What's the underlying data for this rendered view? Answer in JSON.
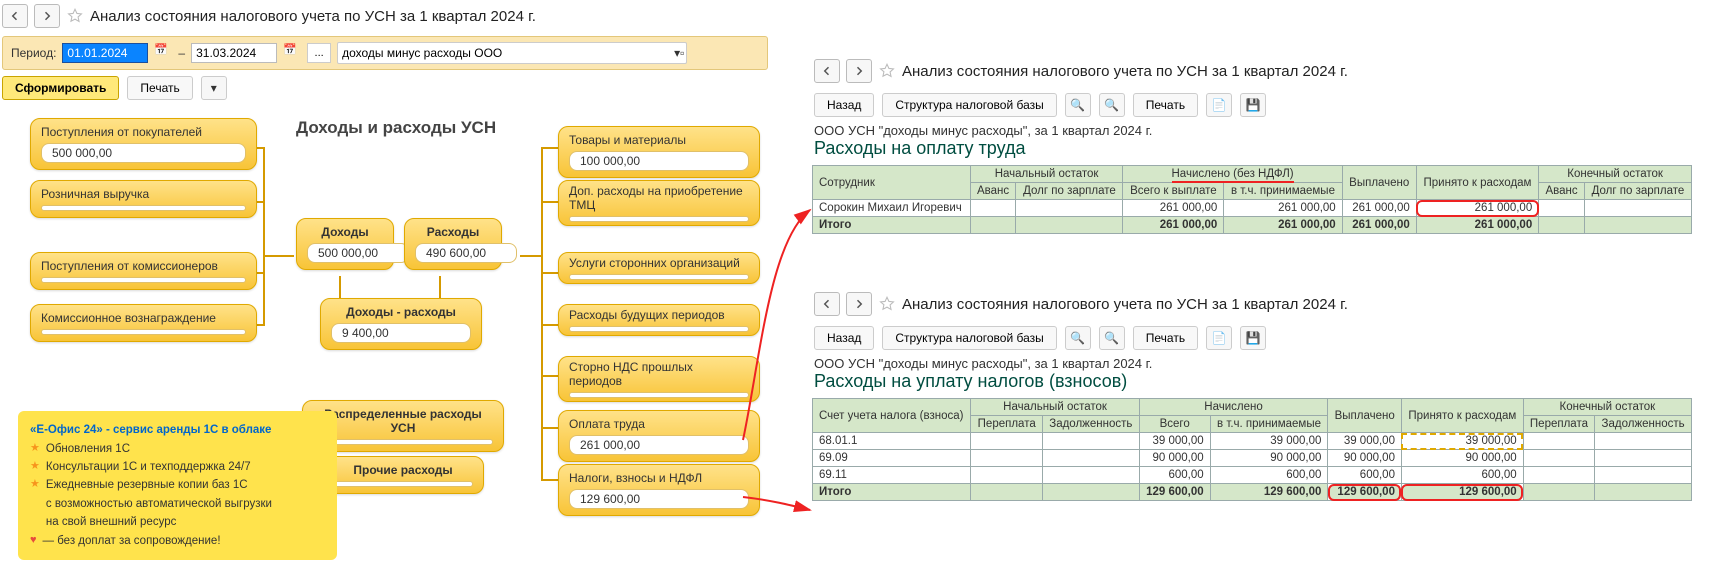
{
  "left": {
    "title": "Анализ состояния налогового учета по УСН за 1 квартал 2024 г.",
    "period_label": "Период:",
    "date_from": "01.01.2024",
    "date_to": "31.03.2024",
    "ndash": "–",
    "combo": "доходы минус расходы ООО",
    "btn_form": "Сформировать",
    "btn_print": "Печать",
    "diag_title": "Доходы и расходы УСН",
    "nodes": {
      "n1": {
        "t": "Поступления от покупателей",
        "v": "500 000,00"
      },
      "n2": {
        "t": "Розничная выручка",
        "v": ""
      },
      "n3": {
        "t": "Поступления от комиссионеров",
        "v": ""
      },
      "n4": {
        "t": "Комиссионное вознаграждение",
        "v": ""
      },
      "c1": {
        "t": "Доходы",
        "v": "500 000,00"
      },
      "c2": {
        "t": "Расходы",
        "v": "490 600,00"
      },
      "c3": {
        "t": "Доходы - расходы",
        "v": "9 400,00"
      },
      "c4": {
        "t": "Распределенные расходы УСН",
        "v": ""
      },
      "c5": {
        "t": "Прочие расходы",
        "v": ""
      },
      "r1": {
        "t": "Товары и материалы",
        "v": "100 000,00"
      },
      "r2": {
        "t": "Доп. расходы на приобретение ТМЦ",
        "v": ""
      },
      "r3": {
        "t": "Услуги сторонних организаций",
        "v": ""
      },
      "r4": {
        "t": "Расходы будущих периодов",
        "v": ""
      },
      "r5": {
        "t": "Сторно НДС прошлых периодов",
        "v": ""
      },
      "r6": {
        "t": "Оплата труда",
        "v": "261 000,00"
      },
      "r7": {
        "t": "Налоги, взносы и НДФЛ",
        "v": "129 600,00"
      }
    },
    "promo": {
      "h": "«Е-Офис 24» - сервис аренды 1С в облаке",
      "l1": "Обновления 1С",
      "l2": "Консультации 1С и техподдержка 24/7",
      "l3a": "Ежедневные резервные копии баз 1С",
      "l3b": "с возможностью автоматической выгрузки",
      "l3c": "на свой внешний ресурс",
      "l4": "— без доплат за сопровождение!"
    }
  },
  "right": {
    "title": "Анализ состояния налогового учета по УСН за 1 квартал 2024 г.",
    "btn_back": "Назад",
    "btn_struct": "Структура налоговой базы",
    "btn_print": "Печать",
    "ctx": "ООО УСН \"доходы минус расходы\",  за 1 квартал 2024 г.",
    "r1": {
      "title": "Расходы на оплату труда",
      "h_emp": "Сотрудник",
      "h_beg": "Начальный остаток",
      "h_avans": "Аванс",
      "h_dolg": "Долг по зарплате",
      "h_nach": "Начислено (без НДФЛ)",
      "h_vsego": "Всего к выплате",
      "h_prin": "в т.ч. принимаемые",
      "h_vypl": "Выплачено",
      "h_rash": "Принято к расходам",
      "h_end": "Конечный остаток",
      "row_name": "Сорокин Михаил Игоревич",
      "val": "261 000,00",
      "tot": "Итого"
    },
    "r2": {
      "title": "Расходы на уплату налогов (взносов)",
      "h_acc": "Счет учета налога (взноса)",
      "h_beg": "Начальный остаток",
      "h_pere": "Переплата",
      "h_zad": "Задолженность",
      "h_nach": "Начислено",
      "h_vsego": "Всего",
      "h_prin": "в т.ч. принимаемые",
      "h_vypl": "Выплачено",
      "h_rash": "Принято к расходам",
      "h_end": "Конечный остаток",
      "rows": [
        {
          "acc": "68.01.1",
          "v": "39 000,00"
        },
        {
          "acc": "69.09",
          "v": "90 000,00"
        },
        {
          "acc": "69.11",
          "v": "600,00"
        }
      ],
      "tot": "Итого",
      "tot_v": "129 600,00"
    }
  }
}
